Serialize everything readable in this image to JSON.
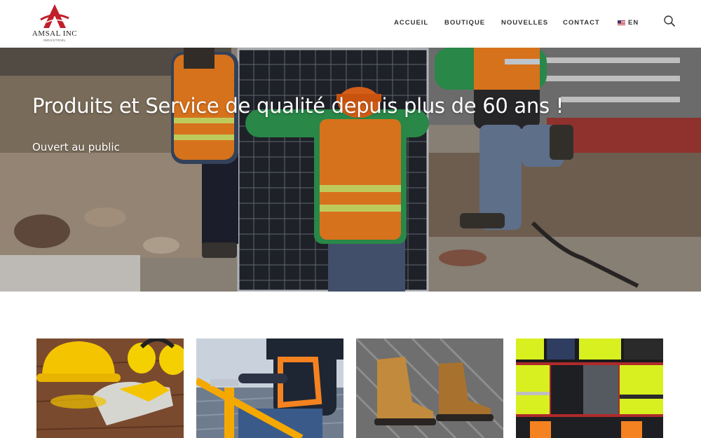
{
  "brand": {
    "name": "AMSAL INC",
    "tagline": "INDUSTRIEL",
    "accent": "#c0202a"
  },
  "nav": {
    "items": [
      {
        "label": "ACCUEIL"
      },
      {
        "label": "BOUTIQUE"
      },
      {
        "label": "NOUVELLES"
      },
      {
        "label": "CONTACT"
      }
    ],
    "language": {
      "label": "EN",
      "icon": "us-flag-icon"
    },
    "search_icon": "search-icon"
  },
  "hero": {
    "title": "Produits et Service de qualité depuis plus de 60 ans !",
    "subtitle": "Ouvert au public"
  },
  "categories": [
    {
      "name": "hard-hat-gloves-earmuffs"
    },
    {
      "name": "fall-protection-harness"
    },
    {
      "name": "safety-boots"
    },
    {
      "name": "hi-vis-workwear"
    }
  ],
  "colors": {
    "safety_orange": "#f58220",
    "hi_vis_yellow": "#d8f020",
    "hard_hat_yellow": "#f5c400"
  }
}
